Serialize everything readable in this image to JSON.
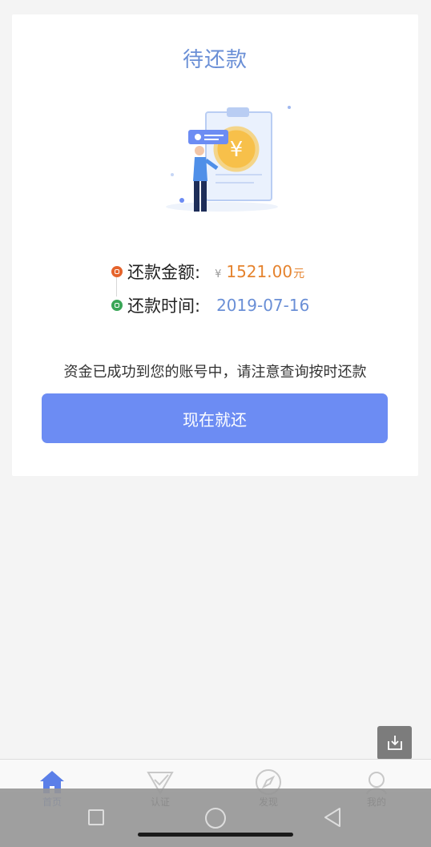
{
  "card": {
    "title": "待还款",
    "repay_amount_label": "还款金额:",
    "currency_symbol": "¥",
    "amount": "1521.00",
    "amount_unit": "元",
    "repay_time_label": "还款时间:",
    "repay_date": "2019-07-16",
    "note": "资金已成功到您的账号中，请注意查询按时还款",
    "repay_button": "现在就还"
  },
  "tabs": [
    {
      "label": "首页",
      "icon": "home-icon",
      "active": true
    },
    {
      "label": "认证",
      "icon": "verify-icon",
      "active": false
    },
    {
      "label": "发现",
      "icon": "compass-icon",
      "active": false
    },
    {
      "label": "我的",
      "icon": "profile-icon",
      "active": false
    }
  ],
  "colors": {
    "accent": "#6c8cf3",
    "title": "#6a8fd6",
    "amount": "#e5832e",
    "amount_dot": "#e5642c",
    "time_dot": "#3aa657"
  }
}
